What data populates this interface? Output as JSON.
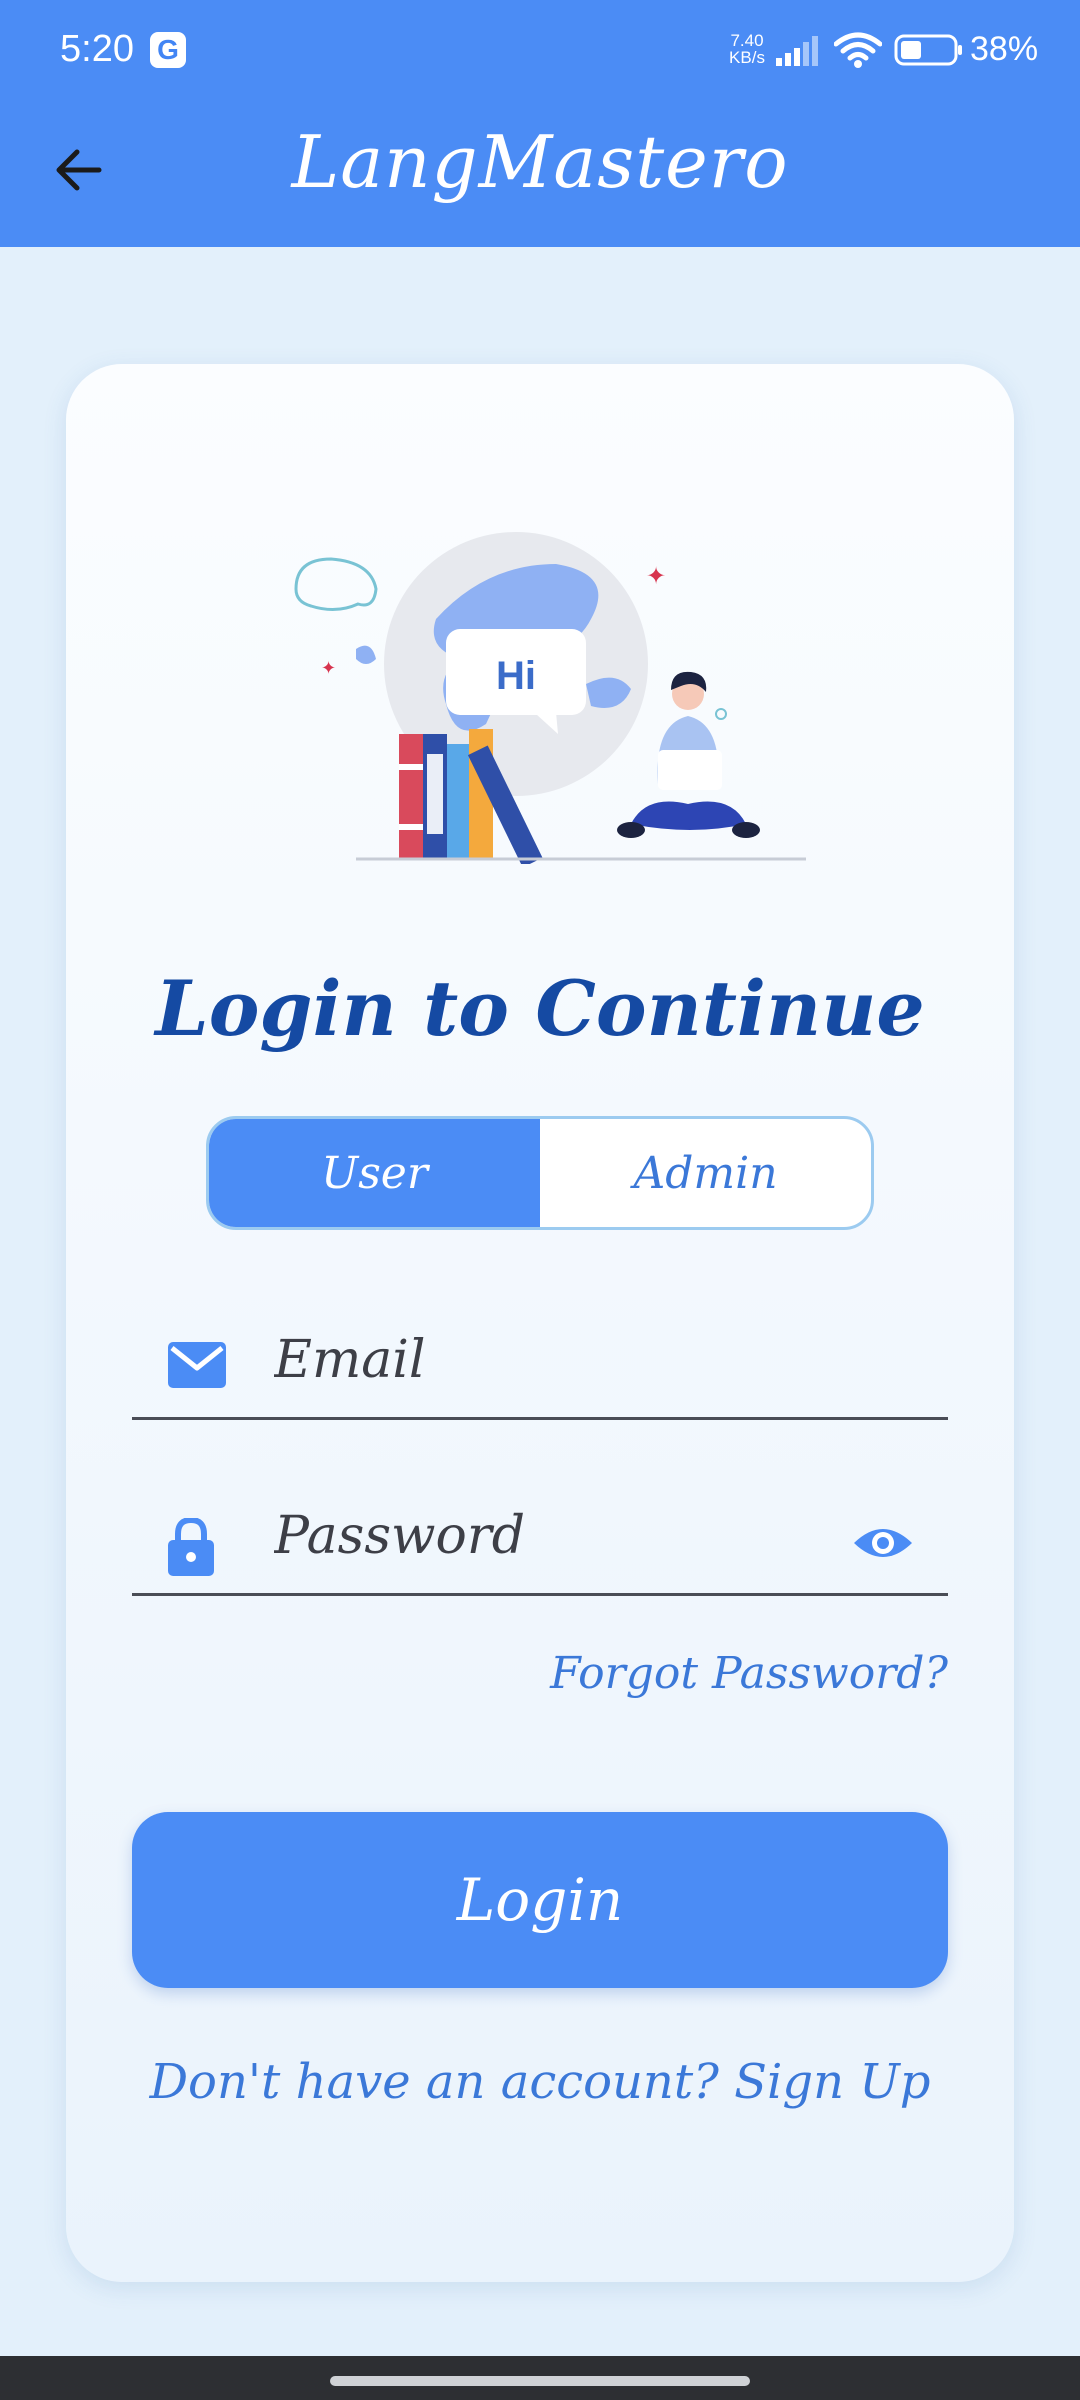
{
  "status_bar": {
    "time": "5:20",
    "google_badge": "G",
    "net_speed_value": "7.40",
    "net_speed_unit": "KB/s",
    "battery_percent": "38%"
  },
  "app_bar": {
    "title": "LangMastero",
    "back_icon": "arrow-left-icon"
  },
  "card": {
    "illustration_text": "Hi",
    "heading": "Login to Continue",
    "role_toggle": {
      "options": [
        "User",
        "Admin"
      ],
      "selected": "User"
    },
    "email_field": {
      "placeholder": "Email",
      "value": "",
      "icon": "envelope-icon"
    },
    "password_field": {
      "placeholder": "Password",
      "value": "",
      "icon": "lock-icon",
      "toggle_icon": "eye-icon"
    },
    "forgot_password": "Forgot Password?",
    "login_button": "Login",
    "signup_prompt": "Don't have an account?",
    "signup_link": "Sign Up"
  },
  "colors": {
    "primary": "#4b8cf5",
    "heading": "#154aa3",
    "link": "#3b78d8",
    "background": "#e3f0fb"
  }
}
